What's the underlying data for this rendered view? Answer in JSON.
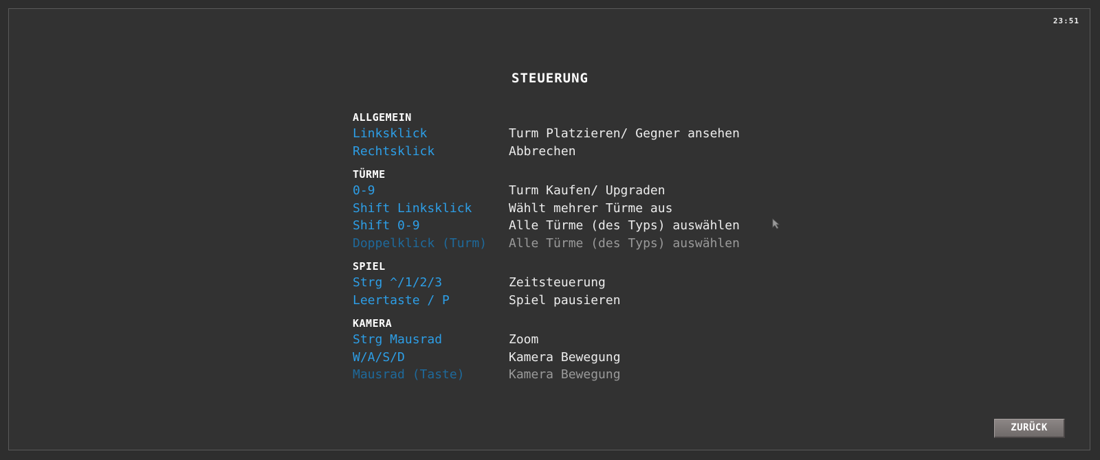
{
  "clock": "23:51",
  "title": "STEUERUNG",
  "sections": [
    {
      "title": "ALLGEMEIN",
      "rows": [
        {
          "key": "Linksklick",
          "desc": "Turm Platzieren/ Gegner ansehen"
        },
        {
          "key": "Rechtsklick",
          "desc": "Abbrechen"
        }
      ]
    },
    {
      "title": "TÜRME",
      "rows": [
        {
          "key": "0-9",
          "desc": "Turm Kaufen/ Upgraden"
        },
        {
          "key": "Shift Linksklick",
          "desc": "Wählt mehrer Türme aus"
        },
        {
          "key": "Shift 0-9",
          "desc": "Alle Türme (des Typs) auswählen"
        },
        {
          "key": "Doppelklick (Turm)",
          "desc": "Alle Türme (des Typs) auswählen"
        }
      ]
    },
    {
      "title": "SPIEL",
      "rows": [
        {
          "key": "Strg ^/1/2/3",
          "desc": "Zeitsteuerung"
        },
        {
          "key": "Leertaste / P",
          "desc": "Spiel pausieren"
        }
      ]
    },
    {
      "title": "KAMERA",
      "rows": [
        {
          "key": "Strg Mausrad",
          "desc": "Zoom"
        },
        {
          "key": "W/A/S/D",
          "desc": "Kamera Bewegung"
        },
        {
          "key": "Mausrad (Taste)",
          "desc": "Kamera Bewegung"
        }
      ]
    }
  ],
  "back_button": "ZURÜCK",
  "colors": {
    "background": "#323232",
    "key": "#2d9ee6",
    "key_dim": "#1e6a9c",
    "desc": "#ececec",
    "desc_dim": "#9a9a9a",
    "button": "#7d7877"
  },
  "icons": {
    "cursor": "mouse-pointer-icon"
  }
}
